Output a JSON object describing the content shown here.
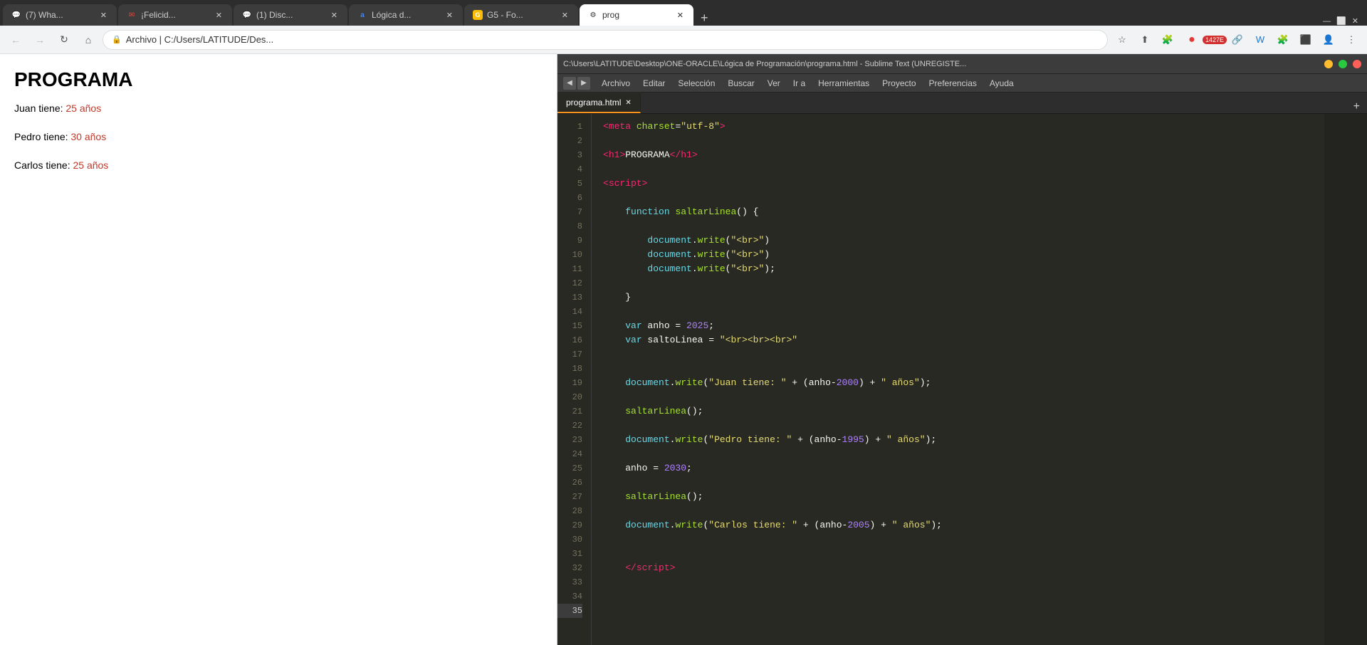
{
  "chrome": {
    "tabs": [
      {
        "id": "tab1",
        "favicon": "💬",
        "label": "(7) Wha...",
        "active": false,
        "closable": true
      },
      {
        "id": "tab2",
        "favicon": "✉",
        "label": "¡Felicid...",
        "active": false,
        "closable": true
      },
      {
        "id": "tab3",
        "favicon": "💬",
        "label": "(1) Disc...",
        "active": false,
        "closable": true
      },
      {
        "id": "tab4",
        "favicon": "a",
        "label": "Lógica d...",
        "active": false,
        "closable": true
      },
      {
        "id": "tab5",
        "favicon": "G",
        "label": "G5 - Fo...",
        "active": false,
        "closable": true
      },
      {
        "id": "tab6",
        "favicon": "⚙",
        "label": "prog",
        "active": true,
        "closable": true
      }
    ],
    "nav": {
      "address": "C:/Users/LATITUDE/Des...",
      "full_address": "C:\\Users\\LATITUDE\\Desktop\\..."
    }
  },
  "browser": {
    "title": "PROGRAMA",
    "lines": [
      {
        "label": "Juan tiene: ",
        "value": "25 años"
      },
      {
        "label": "Pedro tiene: ",
        "value": "30 años"
      },
      {
        "label": "Carlos tiene: ",
        "value": "25 años"
      }
    ]
  },
  "sublime": {
    "title_bar": "C:\\Users\\LATITUDE\\Desktop\\ONE-ORACLE\\Lógica de Programación\\programa.html - Sublime Text (UNREGISTE...",
    "menu": [
      "Archivo",
      "Editar",
      "Selección",
      "Buscar",
      "Ver",
      "Ir a",
      "Herramientas",
      "Proyecto",
      "Preferencias",
      "Ayuda"
    ],
    "tab_name": "programa.html",
    "lines": [
      {
        "n": 1,
        "code": "<span class='tag'>&lt;</span><span class='tag-name'>meta</span> <span class='attr'>charset</span>=<span class='val'>\"utf-8\"</span><span class='tag'>&gt;</span>"
      },
      {
        "n": 2,
        "code": ""
      },
      {
        "n": 3,
        "code": "<span class='tag'>&lt;</span><span class='tag-name'>h1</span><span class='tag'>&gt;</span>PROGRAMA<span class='tag'>&lt;/</span><span class='tag-name'>h1</span><span class='tag'>&gt;</span>"
      },
      {
        "n": 4,
        "code": ""
      },
      {
        "n": 5,
        "code": "<span class='tag'>&lt;</span><span class='tag-name'>script</span><span class='tag'>&gt;</span>"
      },
      {
        "n": 6,
        "code": ""
      },
      {
        "n": 7,
        "code": "    <span class='kw'>function</span> <span class='fn'>saltarLinea</span>() {"
      },
      {
        "n": 8,
        "code": ""
      },
      {
        "n": 9,
        "code": "        <span class='obj'>document</span>.<span class='fn'>write</span>(<span class='str'>\"&lt;br&gt;\"</span>)"
      },
      {
        "n": 10,
        "code": "        <span class='obj'>document</span>.<span class='fn'>write</span>(<span class='str'>\"&lt;br&gt;\"</span>)"
      },
      {
        "n": 11,
        "code": "        <span class='obj'>document</span>.<span class='fn'>write</span>(<span class='str'>\"&lt;br&gt;\"</span>);"
      },
      {
        "n": 12,
        "code": ""
      },
      {
        "n": 13,
        "code": "    }"
      },
      {
        "n": 14,
        "code": ""
      },
      {
        "n": 15,
        "code": "    <span class='kw'>var</span> anho = <span class='num'>2025</span>;"
      },
      {
        "n": 16,
        "code": "    <span class='kw'>var</span> saltoLinea = <span class='str'>\"&lt;br&gt;&lt;br&gt;&lt;br&gt;\"</span>"
      },
      {
        "n": 17,
        "code": ""
      },
      {
        "n": 18,
        "code": ""
      },
      {
        "n": 19,
        "code": "    <span class='obj'>document</span>.<span class='fn'>write</span>(<span class='str'>\"Juan tiene: \"</span> + (anho-<span class='num'>2000</span>) + <span class='str'>\" años\"</span>);"
      },
      {
        "n": 20,
        "code": ""
      },
      {
        "n": 21,
        "code": "    <span class='fn'>saltarLinea</span>();"
      },
      {
        "n": 22,
        "code": ""
      },
      {
        "n": 23,
        "code": "    <span class='obj'>document</span>.<span class='fn'>write</span>(<span class='str'>\"Pedro tiene: \"</span> + (anho-<span class='num'>1995</span>) + <span class='str'>\" años\"</span>);"
      },
      {
        "n": 24,
        "code": ""
      },
      {
        "n": 25,
        "code": "    anho = <span class='num'>2030</span>;"
      },
      {
        "n": 26,
        "code": ""
      },
      {
        "n": 27,
        "code": "    <span class='fn'>saltarLinea</span>();"
      },
      {
        "n": 28,
        "code": ""
      },
      {
        "n": 29,
        "code": "    <span class='obj'>document</span>.<span class='fn'>write</span>(<span class='str'>\"Carlos tiene: \"</span> + (anho-<span class='num'>2005</span>) + <span class='str'>\" años\"</span>);"
      },
      {
        "n": 30,
        "code": ""
      },
      {
        "n": 31,
        "code": ""
      },
      {
        "n": 32,
        "code": "    <span class='tag'>&lt;/</span><span class='tag-name'>script</span><span class='tag'>&gt;</span>"
      },
      {
        "n": 33,
        "code": ""
      },
      {
        "n": 34,
        "code": ""
      },
      {
        "n": 35,
        "code": ""
      }
    ]
  }
}
